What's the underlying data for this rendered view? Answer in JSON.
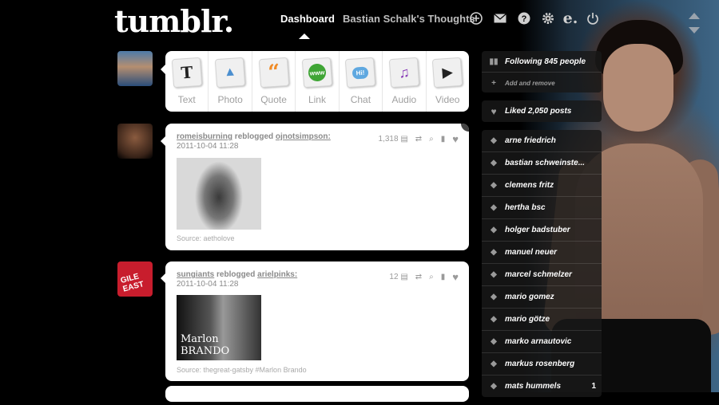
{
  "header": {
    "logo": "tumblr.",
    "tabs": [
      {
        "label": "Dashboard",
        "active": true
      },
      {
        "label": "Bastian Schalk's Thoughts",
        "active": false
      }
    ],
    "icons": [
      "plus-icon",
      "mail-icon",
      "help-icon",
      "gear-icon",
      "edit-icon",
      "power-icon"
    ]
  },
  "composer": {
    "types": [
      {
        "label": "Text",
        "icon": "text-icon",
        "glyph": "T"
      },
      {
        "label": "Photo",
        "icon": "photo-icon",
        "glyph": "▲"
      },
      {
        "label": "Quote",
        "icon": "quote-icon",
        "glyph": "“"
      },
      {
        "label": "Link",
        "icon": "link-icon",
        "glyph": "www"
      },
      {
        "label": "Chat",
        "icon": "chat-icon",
        "glyph": "Hi!"
      },
      {
        "label": "Audio",
        "icon": "audio-icon",
        "glyph": "♫"
      },
      {
        "label": "Video",
        "icon": "video-icon",
        "glyph": "▶"
      }
    ]
  },
  "posts": [
    {
      "user": "romeisburning",
      "action": "reblogged",
      "source_user": "ojnotsimpson:",
      "date": "2011-10-04 11:28",
      "notes": "1,318",
      "source": "Source: aetholove"
    },
    {
      "user": "sungiants",
      "action": "reblogged",
      "source_user": "arielpinks:",
      "date": "2011-10-04 11:28",
      "notes": "12",
      "image_caption": "Marlon BRANDO",
      "source": "Source: thegreat-gatsby   #Marlon Brando"
    }
  ],
  "avatars": {
    "third_text": "GILE\nEAST"
  },
  "sidebar": {
    "following": "Following 845 people",
    "add_remove": "Add and remove",
    "liked": "Liked 2,050 posts",
    "tags": [
      {
        "label": "arne friedrich",
        "count": ""
      },
      {
        "label": "bastian schweinste...",
        "count": ""
      },
      {
        "label": "clemens fritz",
        "count": ""
      },
      {
        "label": "hertha bsc",
        "count": ""
      },
      {
        "label": "holger badstuber",
        "count": ""
      },
      {
        "label": "manuel neuer",
        "count": ""
      },
      {
        "label": "marcel schmelzer",
        "count": ""
      },
      {
        "label": "mario gomez",
        "count": ""
      },
      {
        "label": "mario götze",
        "count": ""
      },
      {
        "label": "marko arnautovic",
        "count": ""
      },
      {
        "label": "markus rosenberg",
        "count": ""
      },
      {
        "label": "mats hummels",
        "count": "1"
      }
    ]
  }
}
